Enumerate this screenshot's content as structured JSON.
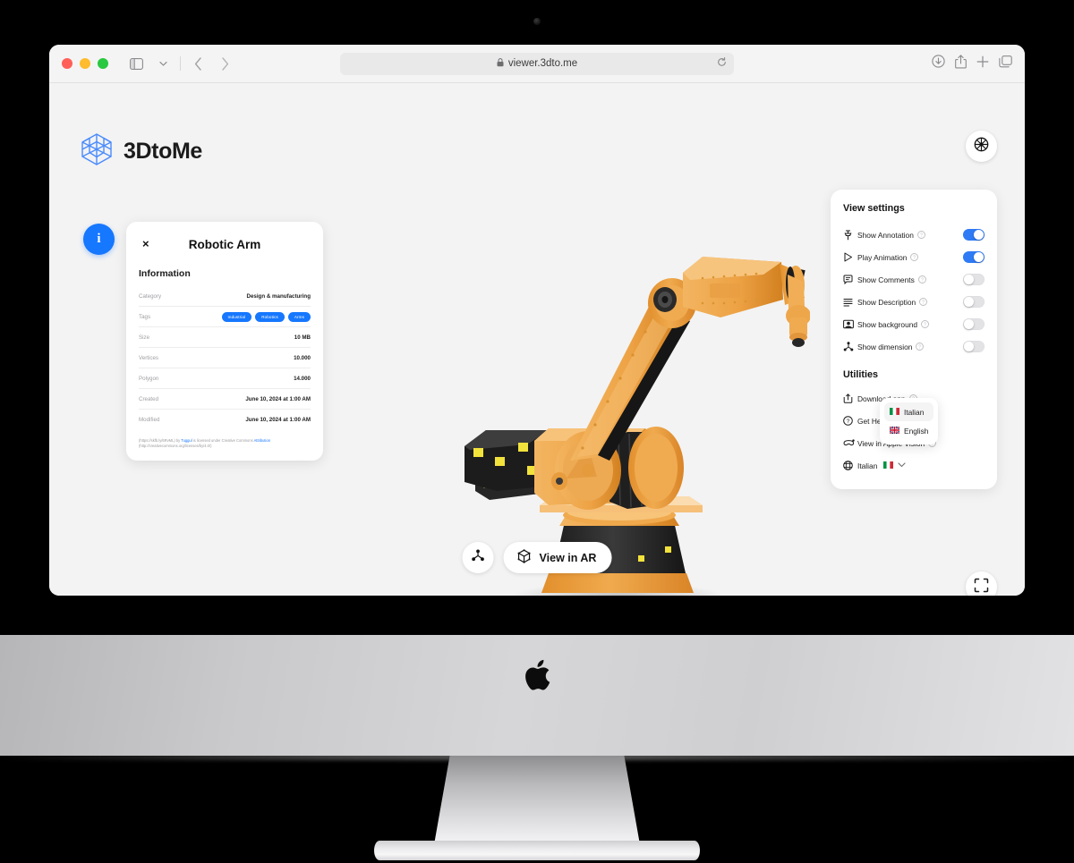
{
  "browser": {
    "url": "viewer.3dto.me",
    "lock_icon": "lock-icon",
    "reload_icon": "reload-icon",
    "sidebar_icon": "sidebar-icon",
    "back_icon": "back-chevron-icon",
    "forward_icon": "forward-chevron-icon",
    "download_icon": "download-icon",
    "share_icon": "share-icon",
    "newtab_icon": "plus-icon",
    "tabs_icon": "tab-overview-icon"
  },
  "brand": {
    "name": "3DtoMe",
    "logo_icon": "cube-wireframe-icon",
    "accent": "#4a8bfc"
  },
  "info_button": {
    "label": "i",
    "icon": "info-icon",
    "color": "#1677ff"
  },
  "info_card": {
    "close_label": "×",
    "title": "Robotic Arm",
    "section_title": "Information",
    "rows": [
      {
        "key": "Category",
        "value": "Design & manufacturing"
      },
      {
        "key": "Tags",
        "value": ""
      },
      {
        "key": "Size",
        "value": "10 MB"
      },
      {
        "key": "Vertices",
        "value": "10.000"
      },
      {
        "key": "Polygon",
        "value": "14.000"
      },
      {
        "key": "Created",
        "value": "June 10, 2024 at 1:00 AM"
      },
      {
        "key": "Modified",
        "value": "June 10, 2024 at 1:00 AM"
      }
    ],
    "tags": [
      "Industrial",
      "Robotics",
      "Arms"
    ],
    "credit_prefix": "(https://skfb.ly/6RvML) by ",
    "credit_link": "Tuggul",
    "credit_mid": " is licensed under Creative Commons ",
    "credit_link2": "Attribution",
    "credit_suffix": " (http://creativecommons.org/licenses/by/4.0/)"
  },
  "settings": {
    "view_settings_title": "View settings",
    "items": [
      {
        "label": "Show Annotation",
        "icon": "pin-icon",
        "state": "on"
      },
      {
        "label": "Play Animation",
        "icon": "play-icon",
        "state": "on"
      },
      {
        "label": "Show Comments",
        "icon": "comment-icon",
        "state": "off"
      },
      {
        "label": "Show Description",
        "icon": "lines-icon",
        "state": "off"
      },
      {
        "label": "Show background",
        "icon": "image-icon",
        "state": "off"
      },
      {
        "label": "Show dimension",
        "icon": "dimension-icon",
        "state": "off"
      }
    ],
    "utilities_title": "Utilities",
    "utilities": [
      {
        "label": "Download app",
        "icon": "download-box-icon"
      },
      {
        "label": "Get Help",
        "icon": "question-circle-icon"
      },
      {
        "label": "View in Apple Vision",
        "icon": "vision-pro-icon"
      }
    ],
    "language": {
      "label": "Italian",
      "flag": "🇮🇹",
      "icon": "globe-icon",
      "chevron": "⌄"
    },
    "help_icon": "question-mark-icon",
    "toggle_on_color": "#2f7bf6",
    "toggle_off_color": "#e3e3e6"
  },
  "language_menu": {
    "options": [
      {
        "label": "Italian",
        "flag": "🇮🇹",
        "selected": true
      },
      {
        "label": "English",
        "flag": "🇬🇧",
        "selected": false
      }
    ]
  },
  "viewer_controls": {
    "gear_icon": "gear-icon",
    "fullscreen_icon": "fullscreen-icon",
    "dimension_icon": "dimension-icon",
    "ar_label": "View in AR",
    "ar_icon": "ar-cube-icon"
  },
  "model": {
    "name": "Robotic Arm",
    "body_color": "#efa646",
    "dark_color": "#2b2b2b",
    "accent_color": "#f5e03a"
  },
  "device": {
    "brand_icon": "apple-logo-icon",
    "camera_icon": "camera-dot"
  }
}
